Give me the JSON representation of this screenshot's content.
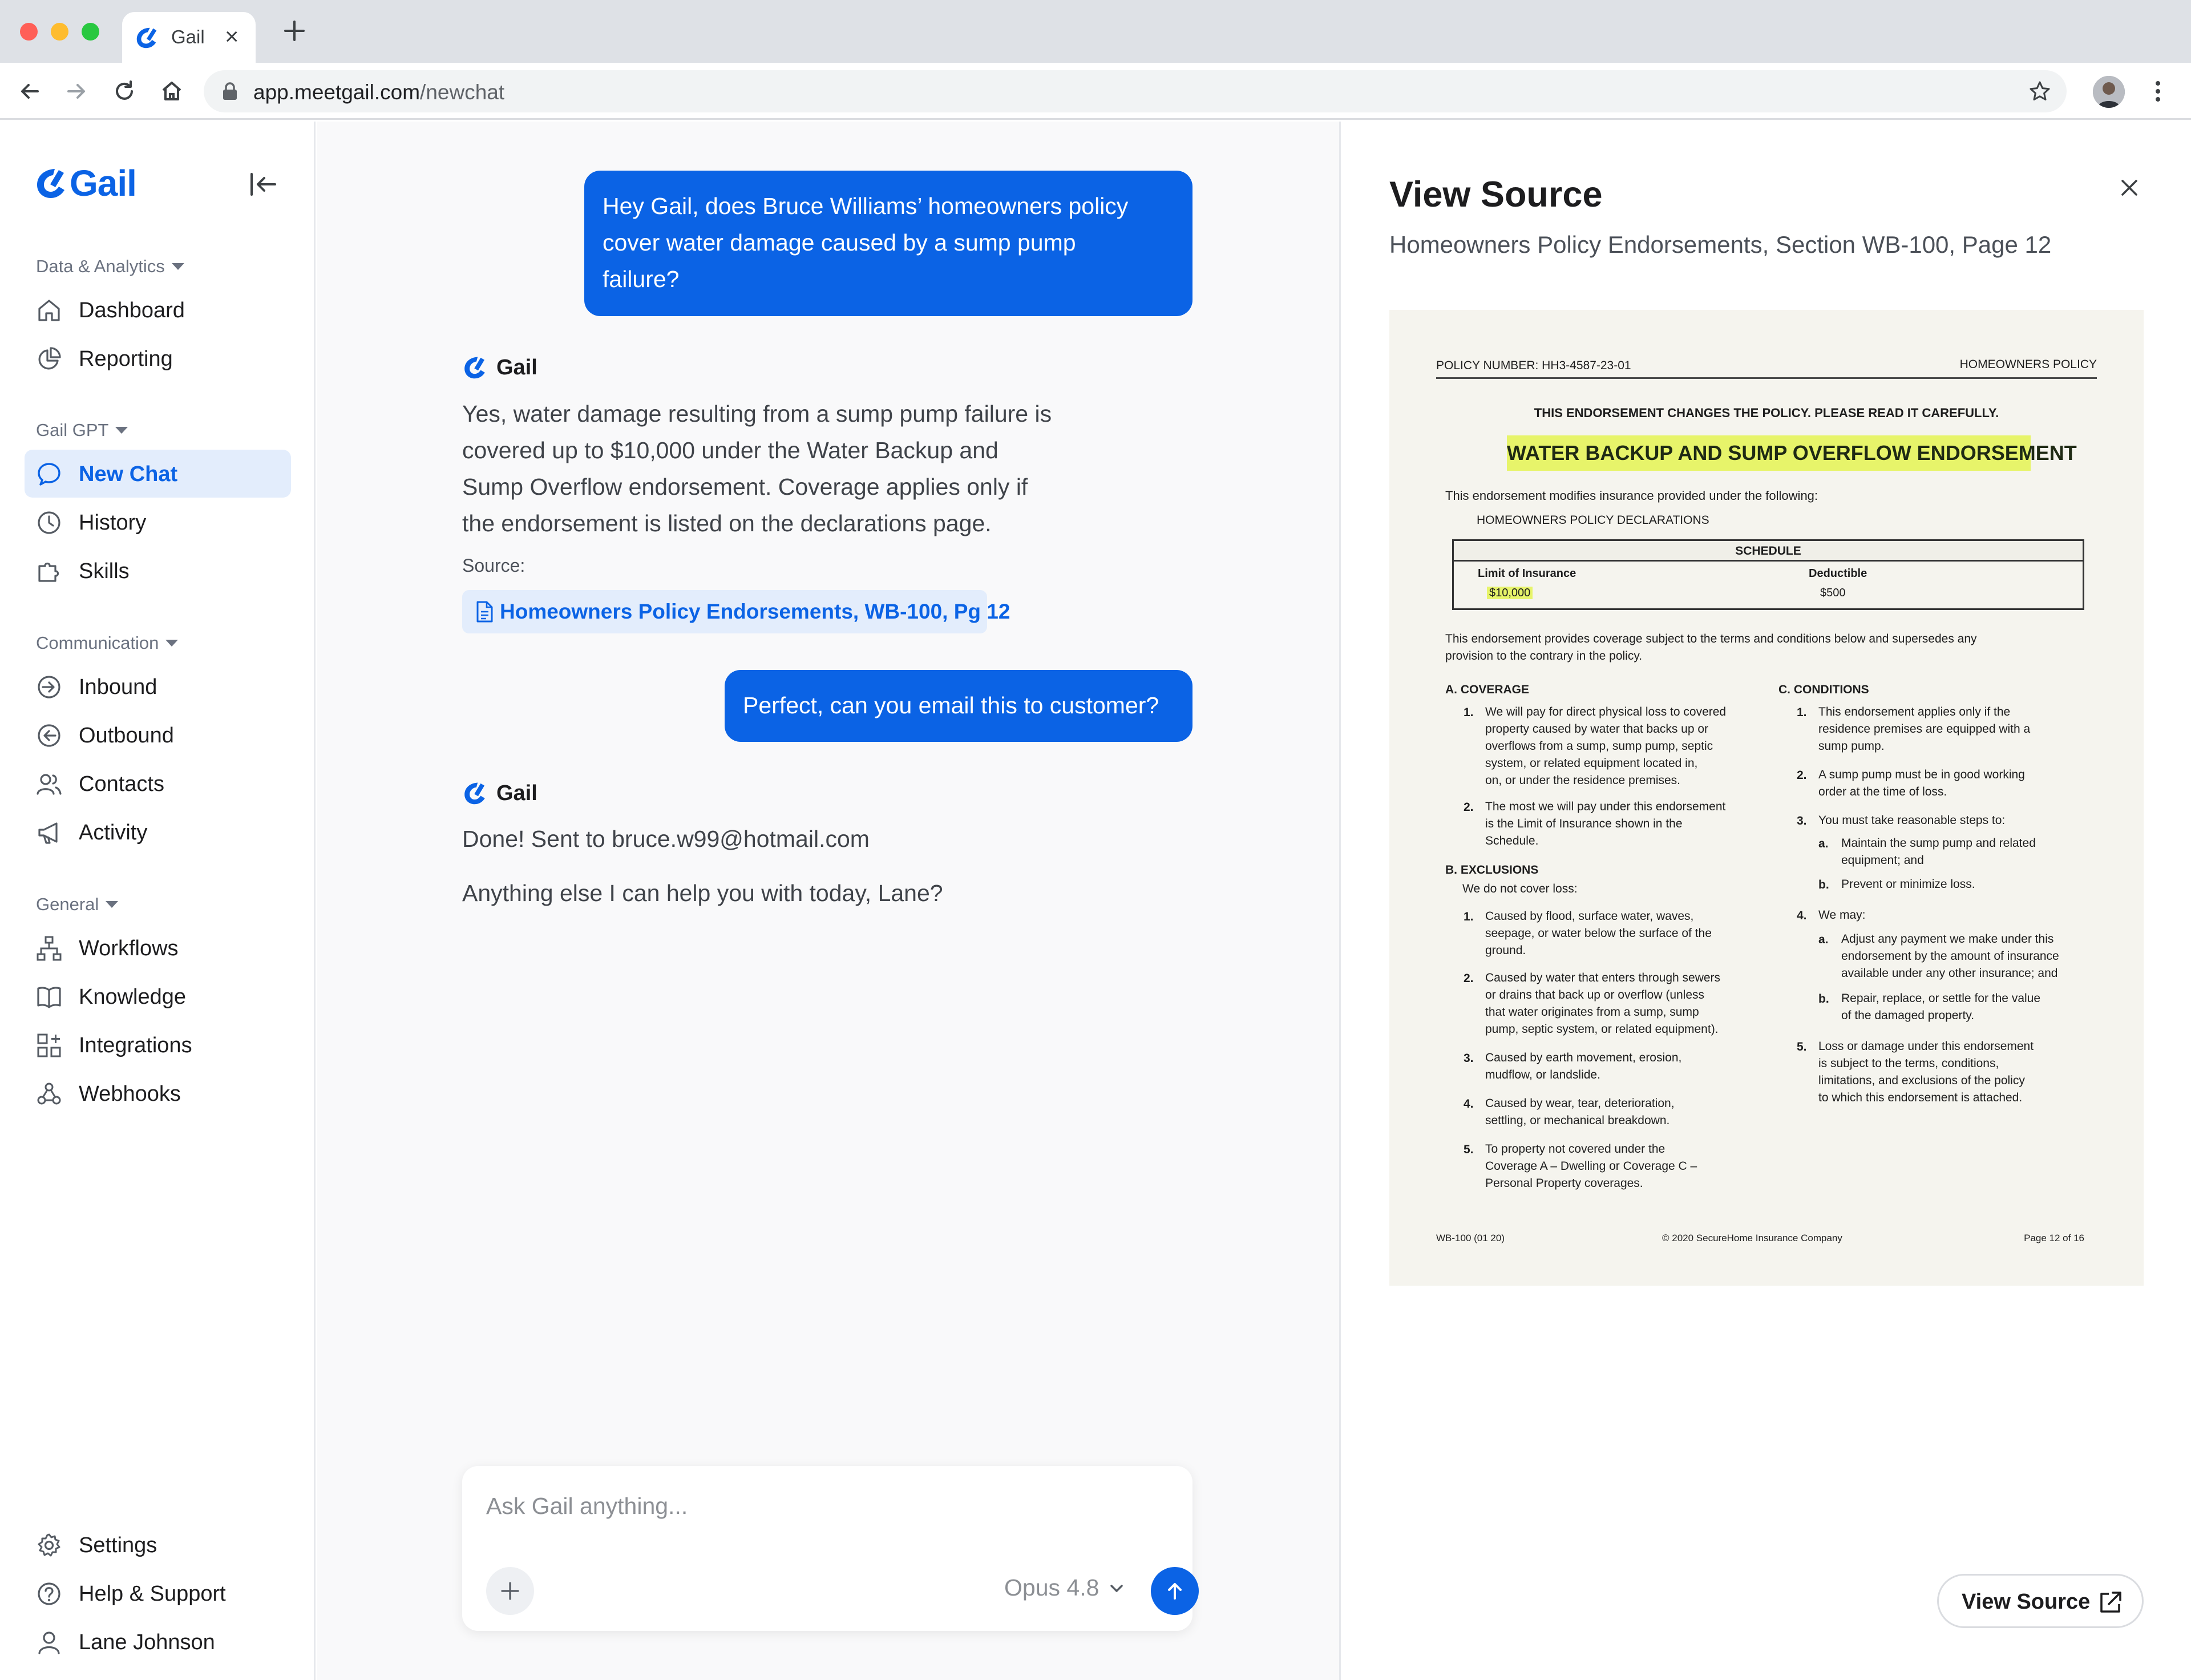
{
  "browser": {
    "tab_title": "Gail",
    "url_host": "app.meetgail.com",
    "url_path": "/newchat"
  },
  "sidebar": {
    "brand": "Gail",
    "groups": [
      {
        "label": "Data & Analytics",
        "items": [
          {
            "label": "Dashboard",
            "icon": "home-icon"
          },
          {
            "label": "Reporting",
            "icon": "pie-chart-icon"
          }
        ]
      },
      {
        "label": "Gail GPT",
        "items": [
          {
            "label": "New Chat",
            "icon": "chat-bubble-icon",
            "active": true
          },
          {
            "label": "History",
            "icon": "clock-icon"
          },
          {
            "label": "Skills",
            "icon": "puzzle-icon"
          }
        ]
      },
      {
        "label": "Communication",
        "items": [
          {
            "label": "Inbound",
            "icon": "inbound-icon"
          },
          {
            "label": "Outbound",
            "icon": "outbound-icon"
          },
          {
            "label": "Contacts",
            "icon": "users-icon"
          },
          {
            "label": "Activity",
            "icon": "megaphone-icon"
          }
        ]
      },
      {
        "label": "General",
        "items": [
          {
            "label": "Workflows",
            "icon": "workflow-icon"
          },
          {
            "label": "Knowledge",
            "icon": "book-icon"
          },
          {
            "label": "Integrations",
            "icon": "grid-plus-icon"
          },
          {
            "label": "Webhooks",
            "icon": "webhook-icon"
          }
        ]
      }
    ],
    "bottom": [
      {
        "label": "Settings",
        "icon": "gear-icon"
      },
      {
        "label": "Help & Support",
        "icon": "help-circle-icon"
      },
      {
        "label": "Lane Johnson",
        "icon": "user-icon"
      }
    ]
  },
  "chat": {
    "user_msg_1": [
      "Hey Gail, does Bruce Williams’ homeowners policy",
      "cover water damage caused by a sump pump",
      "failure?"
    ],
    "assistant_name": "Gail",
    "assistant_msg_1": [
      "Yes, water damage resulting from a sump pump failure is",
      "covered up to $10,000 under the Water Backup and",
      "Sump Overflow endorsement. Coverage applies only if",
      "the endorsement is listed on the declarations page."
    ],
    "source_label": "Source:",
    "source_chip": "Homeowners Policy Endorsements, WB-100, Pg 12",
    "user_msg_2": "Perfect, can you email this to customer?",
    "assistant_msg_2_line1": "Done! Sent to bruce.w99@hotmail.com",
    "assistant_msg_2_line2": "Anything else I can help you with today, Lane?",
    "composer_placeholder": "Ask Gail anything...",
    "model": "Opus 4.8"
  },
  "panel": {
    "title": "View Source",
    "subtitle": "Homeowners Policy Endorsements, Section WB-100, Page 12",
    "button": "View Source",
    "document": {
      "policy_number": "POLICY NUMBER: HH3-4587-23-01",
      "policy_kind": "HOMEOWNERS POLICY",
      "notice": "THIS ENDORSEMENT CHANGES THE POLICY. PLEASE READ IT CAREFULLY.",
      "headline": "WATER BACKUP AND SUMP OVERFLOW ENDORSEMENT",
      "intro": "This endorsement modifies insurance provided under the following:",
      "declarations": "HOMEOWNERS POLICY DECLARATIONS",
      "schedule_title": "SCHEDULE",
      "schedule_limit_label": "Limit of Insurance",
      "schedule_deductible_label": "Deductible",
      "schedule_limit_value": "$10,000",
      "schedule_deductible_value": "$500",
      "provides": [
        "This endorsement provides coverage subject to the terms and conditions below and supersedes any",
        "provision to the contrary in the policy."
      ],
      "coverage_title": "A.  COVERAGE",
      "coverage_items": [
        [
          "We will pay for direct physical loss to covered",
          "property caused by water that backs up or",
          "overflows from a sump, sump pump, septic",
          "system, or related equipment located in,",
          "on, or under the residence premises."
        ],
        [
          "The most we will pay under this endorsement",
          "is the Limit of Insurance shown in the",
          "Schedule."
        ]
      ],
      "exclusions_title": "B.  EXCLUSIONS",
      "exclusions_intro": "We do not cover loss:",
      "exclusion_items": [
        [
          "Caused by flood, surface water, waves,",
          "seepage, or water below the surface of the",
          "ground."
        ],
        [
          "Caused by water that enters through sewers",
          "or drains that back up or overflow (unless",
          "that water originates from a sump, sump",
          "pump, septic system, or related equipment)."
        ],
        [
          "Caused by earth movement, erosion,",
          "mudflow, or landslide."
        ],
        [
          "Caused by wear, tear, deterioration,",
          "settling, or mechanical breakdown."
        ],
        [
          "To property not covered under the",
          "Coverage A – Dwelling or Coverage C –",
          "Personal Property coverages."
        ]
      ],
      "conditions_title": "C.  CONDITIONS",
      "condition_items": [
        [
          "This endorsement applies only if the",
          "residence premises are equipped with a",
          "sump pump."
        ],
        [
          "A sump pump must be in good working",
          "order at the time of loss."
        ],
        [
          "You must take reasonable steps to:"
        ],
        [
          "We may:"
        ],
        [
          "Loss or damage under this endorsement",
          "is subject to the terms, conditions,",
          "limitations, and exclusions of the policy",
          "to which this endorsement is attached."
        ]
      ],
      "condition_3_subs": [
        [
          "Maintain the sump pump and related",
          "equipment; and"
        ],
        [
          "Prevent or minimize loss."
        ]
      ],
      "condition_4_subs": [
        [
          "Adjust any payment we make under this",
          "endorsement by the amount of insurance",
          "available under any other insurance; and"
        ],
        [
          "Repair, replace, or settle for the value",
          "of the damaged property."
        ]
      ],
      "footer_left": "WB-100 (01 20)",
      "footer_center": "© 2020 SecureHome Insurance Company",
      "footer_right": "Page 12 of 16"
    }
  },
  "colors": {
    "accent": "#0b63e5",
    "accent_soft": "#e3edfc",
    "highlight": "#e7f46a"
  }
}
